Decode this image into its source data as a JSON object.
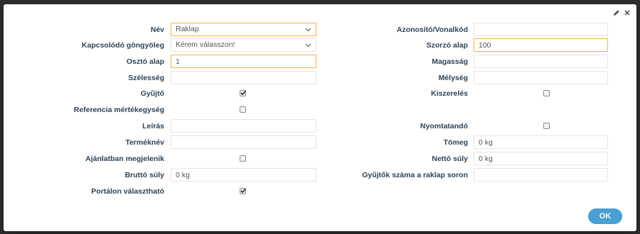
{
  "dialog": {
    "ok_label": "OK",
    "edit_icon": "pencil-icon",
    "close_icon": "close-icon"
  },
  "left": {
    "nev": {
      "label": "Név",
      "value": "Raklap"
    },
    "kapcsolodo": {
      "label": "Kapcsolódó göngyöleg",
      "value": "Kérem válasszon!"
    },
    "oszto_alap": {
      "label": "Osztó alap",
      "value": "1"
    },
    "szelesseg": {
      "label": "Szélesség",
      "value": ""
    },
    "gyujto": {
      "label": "Gyűjtő",
      "checked": true
    },
    "referencia": {
      "label": "Referencia mértékegység",
      "checked": false
    },
    "leiras": {
      "label": "Leírás",
      "value": ""
    },
    "termeknev": {
      "label": "Terméknév",
      "value": ""
    },
    "ajanlatban": {
      "label": "Ajánlatban megjelenik",
      "checked": false
    },
    "brutto": {
      "label": "Bruttó súly",
      "value": "0 kg"
    },
    "portalon": {
      "label": "Portálon választható",
      "checked": true
    }
  },
  "right": {
    "azonosito": {
      "label": "Azonosító/Vonalkód",
      "value": ""
    },
    "szorzo_alap": {
      "label": "Szorzó alap",
      "value": "100"
    },
    "magassag": {
      "label": "Magasság",
      "value": ""
    },
    "melyseg": {
      "label": "Mélység",
      "value": ""
    },
    "kiszereles": {
      "label": "Kiszerelés",
      "checked": false
    },
    "nyomtatando": {
      "label": "Nyomtatandó",
      "checked": false
    },
    "tomeg": {
      "label": "Tömeg",
      "value": "0 kg"
    },
    "netto": {
      "label": "Nettó súly",
      "value": "0 kg"
    },
    "gyujtok_szama": {
      "label": "Gyűjtők száma a raklap soron",
      "value": ""
    }
  },
  "colors": {
    "label": "#2d4358",
    "focus_border": "#f2b446",
    "button": "#4a9fd4"
  }
}
